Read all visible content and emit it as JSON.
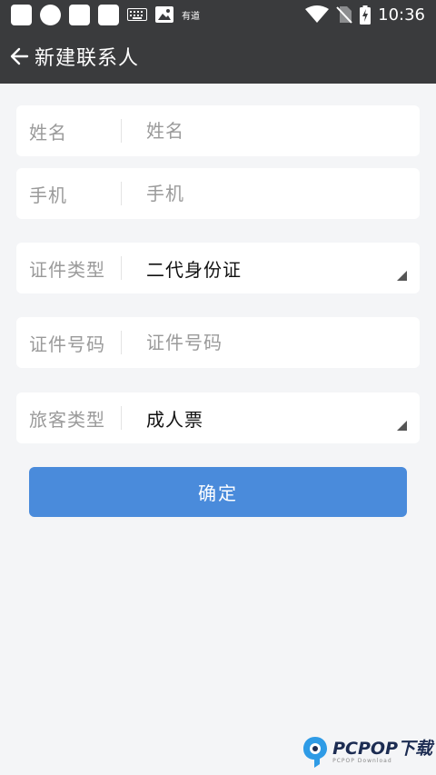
{
  "status_bar": {
    "notification_label": "有道",
    "time": "10:36"
  },
  "app_bar": {
    "title": "新建联系人"
  },
  "form": {
    "name": {
      "label": "姓名",
      "placeholder": "姓名",
      "value": ""
    },
    "phone": {
      "label": "手机",
      "placeholder": "手机",
      "value": ""
    },
    "id_type": {
      "label": "证件类型",
      "value": "二代身份证"
    },
    "id_number": {
      "label": "证件号码",
      "placeholder": "证件号码",
      "value": ""
    },
    "passenger_type": {
      "label": "旅客类型",
      "value": "成人票"
    }
  },
  "confirm_label": "确定",
  "watermark": {
    "text": "PCPOP下载",
    "subtext": "PCPOP Download"
  },
  "colors": {
    "bar_background": "#3a3b3d",
    "accent": "#4a8bdb",
    "page_background": "#f4f5f7"
  }
}
